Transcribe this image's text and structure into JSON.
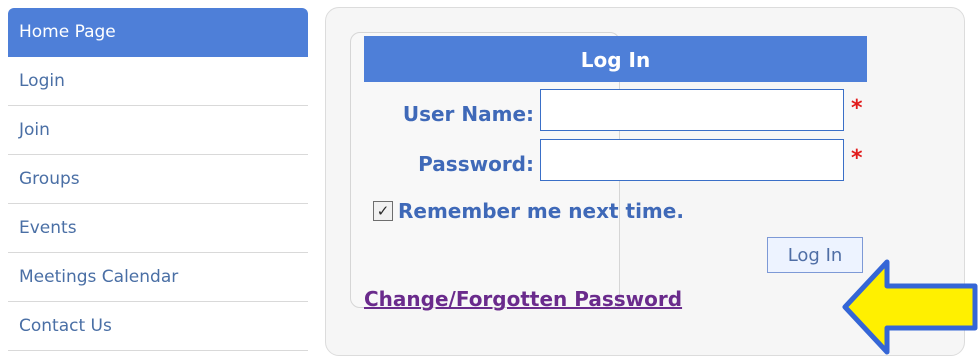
{
  "sidebar": {
    "items": [
      {
        "label": "Home Page",
        "active": true
      },
      {
        "label": "Login",
        "active": false
      },
      {
        "label": "Join",
        "active": false
      },
      {
        "label": "Groups",
        "active": false
      },
      {
        "label": "Events",
        "active": false
      },
      {
        "label": "Meetings Calendar",
        "active": false
      },
      {
        "label": "Contact Us",
        "active": false
      }
    ]
  },
  "login": {
    "header": "Log In",
    "username_label": "User Name:",
    "password_label": "Password:",
    "required_mark": "*",
    "remember_label": "Remember me next time.",
    "remember_checked": true,
    "button_label": "Log In",
    "forgot_link": "Change/Forgotten Password"
  },
  "colors": {
    "accent": "#4E7FD8",
    "label_blue": "#3F69B8",
    "required_red": "#E11B1B",
    "arrow_yellow": "#FFF000",
    "arrow_border": "#3566D6"
  },
  "icons": {
    "checkbox": "checkbox-checked-icon",
    "arrow": "yellow-arrow-left-icon"
  }
}
